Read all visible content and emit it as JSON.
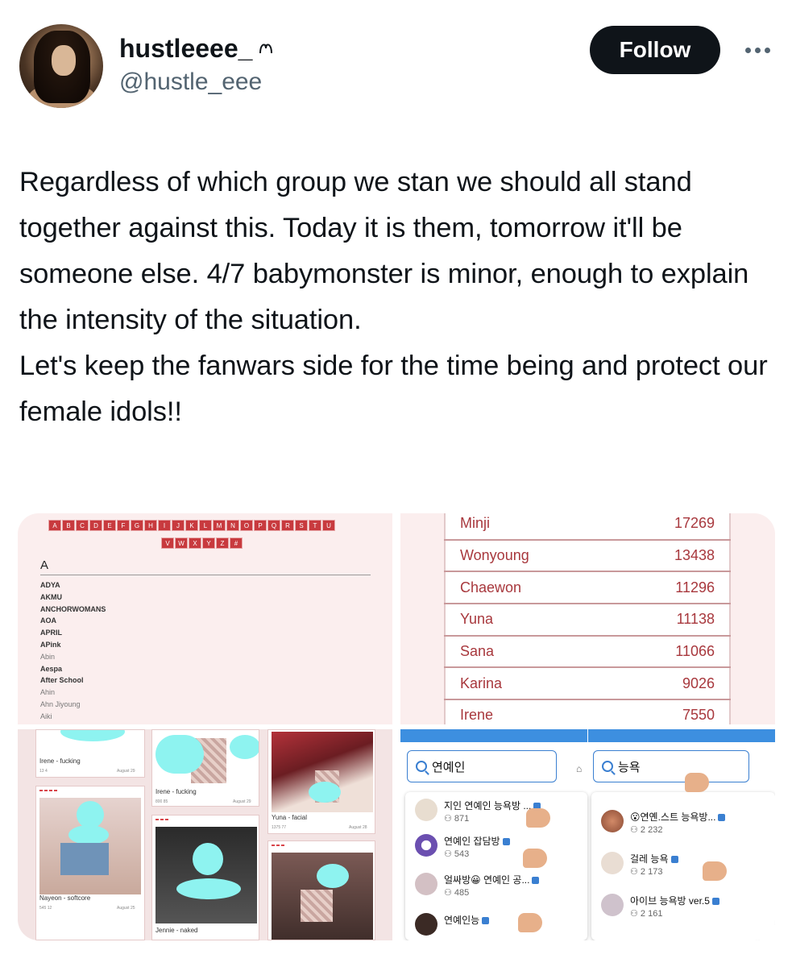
{
  "author": {
    "display_name": "hustleeee_",
    "handle": "@hustle_eee",
    "name_icon": "crown-glyph-icon"
  },
  "actions": {
    "follow_label": "Follow",
    "more_icon": "more-horizontal-icon"
  },
  "tweet": {
    "text": "Regardless of which group we stan we should all stand together against this. Today it is them, tomorrow it'll be someone else. 4/7 babymonster is minor, enough to explain the intensity of the situation.\nLet's keep the fanwars side for the time being and protect our female idols!!"
  },
  "media": {
    "alphabet_row1": [
      "A",
      "B",
      "C",
      "D",
      "E",
      "F",
      "G",
      "H",
      "I",
      "J",
      "K",
      "L",
      "M",
      "N",
      "O",
      "P",
      "Q",
      "R",
      "S",
      "T",
      "U"
    ],
    "alphabet_row2": [
      "V",
      "W",
      "X",
      "Y",
      "Z",
      "#"
    ],
    "section_letter": "A",
    "artists": [
      {
        "name": "ADYA",
        "style": "bold"
      },
      {
        "name": "AKMU",
        "style": "bold"
      },
      {
        "name": "ANCHORWOMANS",
        "style": "bold"
      },
      {
        "name": "AOA",
        "style": "bold"
      },
      {
        "name": "APRIL",
        "style": "bold"
      },
      {
        "name": "APink",
        "style": "bold"
      },
      {
        "name": "Abin",
        "style": "light"
      },
      {
        "name": "Aespa",
        "style": "bold"
      },
      {
        "name": "After School",
        "style": "bold"
      },
      {
        "name": "Ahin",
        "style": "light"
      },
      {
        "name": "Ahn Jiyoung",
        "style": "light"
      },
      {
        "name": "Aiki",
        "style": "light"
      }
    ],
    "ranking": [
      {
        "name": "Minji",
        "value": "17269"
      },
      {
        "name": "Wonyoung",
        "value": "13438"
      },
      {
        "name": "Chaewon",
        "value": "11296"
      },
      {
        "name": "Yuna",
        "value": "11138"
      },
      {
        "name": "Sana",
        "value": "11066"
      },
      {
        "name": "Karina",
        "value": "9026"
      },
      {
        "name": "Irene",
        "value": "7550"
      }
    ],
    "gallery": [
      {
        "caption": "Irene - fucking",
        "meta": "13   4",
        "date": "August 29"
      },
      {
        "caption": "Irene - fucking",
        "meta": "800   85",
        "date": "August 29"
      },
      {
        "caption": "Yuna - facial",
        "meta": "1375   77",
        "date": "August 28"
      },
      {
        "caption": "Nayeon - softcore",
        "meta": "545   12",
        "date": "August 25"
      },
      {
        "caption": "Jennie - naked",
        "meta": "",
        "date": ""
      }
    ],
    "search_left": {
      "query": "연예인",
      "results": [
        {
          "title": "지인 연예인 능욕방 ...",
          "count": "871"
        },
        {
          "title": "연예인 잡담방",
          "count": "543"
        },
        {
          "title": "얼싸방😀 연예인 공...",
          "count": "485"
        },
        {
          "title": "연예인능",
          "count": ""
        }
      ]
    },
    "search_right": {
      "query": "능욕",
      "results": [
        {
          "title": "😮연옌.스트 능욕방...",
          "count": "2 232"
        },
        {
          "title": "걸레 능욕",
          "count": "2 173"
        },
        {
          "title": "아이브 능욕방 ver.5",
          "count": "2 161"
        }
      ]
    }
  }
}
